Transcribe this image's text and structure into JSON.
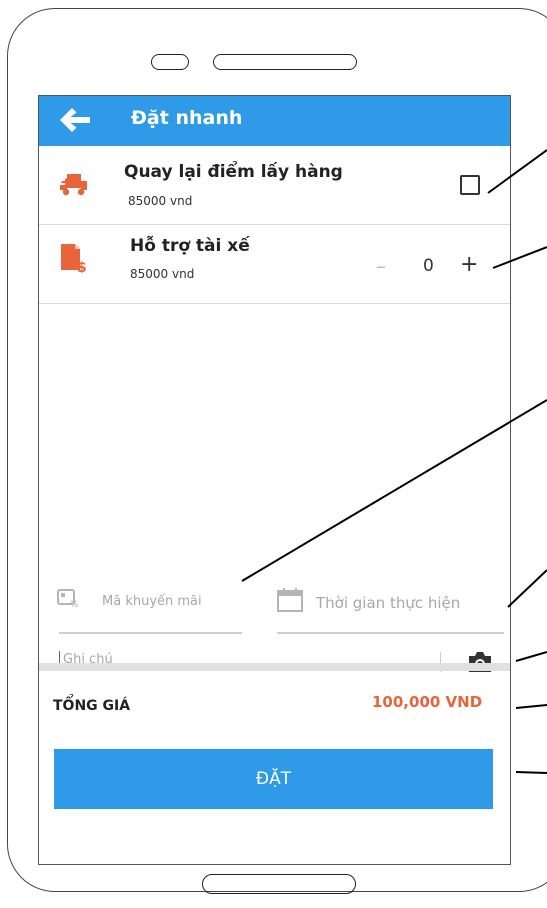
{
  "header": {
    "title": "Đặt nhanh"
  },
  "services": [
    {
      "title": "Quay lại điểm lấy hàng",
      "price": "85000 vnd",
      "icon": "delivery-truck-icon",
      "control": "checkbox",
      "checked": false
    },
    {
      "title": "Hỗ trợ tài xế",
      "price": "85000 vnd",
      "icon": "driver-support-cost-icon",
      "control": "stepper",
      "quantity": "0",
      "minus_label": "–",
      "plus_label": "+"
    }
  ],
  "form": {
    "promo_placeholder": "Mã khuyến mãi",
    "time_placeholder": "Thời gian thực hiện",
    "note_placeholder": "Ghi chú",
    "icons": {
      "promo": "coupon-icon",
      "time": "calendar-icon",
      "note": "camera-icon"
    }
  },
  "summary": {
    "total_label": "TỔNG GIÁ",
    "total_value": "100,000 VND"
  },
  "actions": {
    "order_label": "ĐẶT"
  },
  "colors": {
    "primary": "#2f9ae8",
    "accent": "#e8643a"
  }
}
